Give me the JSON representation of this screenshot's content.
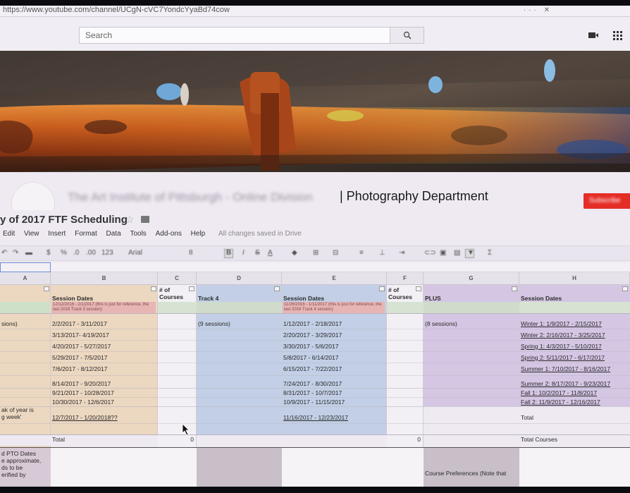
{
  "browser": {
    "url": "https://www.youtube.com/channel/UCgN-cVC7YondcYyaBd74cow"
  },
  "youtube": {
    "search_placeholder": "Search",
    "channel_name_blurred": "The Art Institute of Pittsburgh - Online Division",
    "channel_name_visible": "| Photography Department",
    "subscribe_label": "Subscribe"
  },
  "spreadsheet": {
    "title": "y of 2017 FTF Scheduling",
    "menu": [
      "Edit",
      "View",
      "Insert",
      "Format",
      "Data",
      "Tools",
      "Add-ons",
      "Help"
    ],
    "save_status": "All changes saved in Drive",
    "toolbar": {
      "zoom": "123",
      "font": "Arial",
      "font_size": "8"
    },
    "columns": [
      "A",
      "B",
      "C",
      "D",
      "E",
      "F",
      "G",
      "H"
    ],
    "col_a": {
      "cells": [
        "sions)",
        "ak of year is",
        "g week'",
        "d PTO Dates",
        "e approximate,",
        "ds to be",
        "erified by"
      ]
    },
    "col_b": {
      "header": "Session Dates",
      "note": "12/12/2016 - 2/1/2017 (this is just for reference, the last 2016 Track 3 session)",
      "dates": [
        "2/2/2017 - 3/11/2017",
        "3/13/2017- 4/19/2017",
        "4/20/2017 - 5/27/2017",
        "5/29/2017 - 7/5/2017",
        "7/6/2017 - 8/12/2017",
        "8/14/2017 - 9/20/2017",
        "9/21/2017 - 10/28/2017",
        "10/30/2017 - 12/6/2017",
        "12/7/2017 - 1/20/2018??"
      ],
      "total_label": "Total"
    },
    "col_c": {
      "header": "# of Courses",
      "total_value": "0"
    },
    "col_d": {
      "header": "Track 4",
      "sessions": "(9 sessions)"
    },
    "col_e": {
      "header": "Session Dates",
      "note": "11/26/2016 - 1/11/2017 (this is just for reference, the last 2016 Track 4 session)",
      "dates": [
        "1/12/2017 - 2/18/2017",
        "2/20/2017 - 3/29/2017",
        "3/30/2017 - 5/6/2017",
        "5/8/2017 - 6/14/2017",
        "6/15/2017 - 7/22/2017",
        "7/24/2017 - 8/30/2017",
        "8/31/2017 - 10/7/2017",
        "10/9/2017 - 11/15/2017",
        "11/16/2017 - 12/23/2017"
      ]
    },
    "col_f": {
      "header": "# of Courses",
      "total_value": "0"
    },
    "col_g": {
      "header": "PLUS",
      "sessions": "(8 sessions)",
      "bottom_note": "Course Preferences (Note that"
    },
    "col_h": {
      "header": "Session Dates",
      "dates": [
        "Winter 1: 1/9/2017 - 2/15/2017",
        "Winter 2: 2/16/2017 - 3/25/2017",
        "Spring 1: 4/3/2017 - 5/10/2017",
        "Spring 2: 5/11/2017 - 6/17/2017",
        "Summer 1: 7/10/2017 - 8/16/2017",
        "Summer 2: 8/17/2017 - 9/23/2017",
        "Fall 1: 10/2/2017 - 11/8/2017",
        "Fall 2: 11/9/2017 - 12/16/2017"
      ],
      "total_label": "Total",
      "total_courses_label": "Total Courses"
    }
  }
}
